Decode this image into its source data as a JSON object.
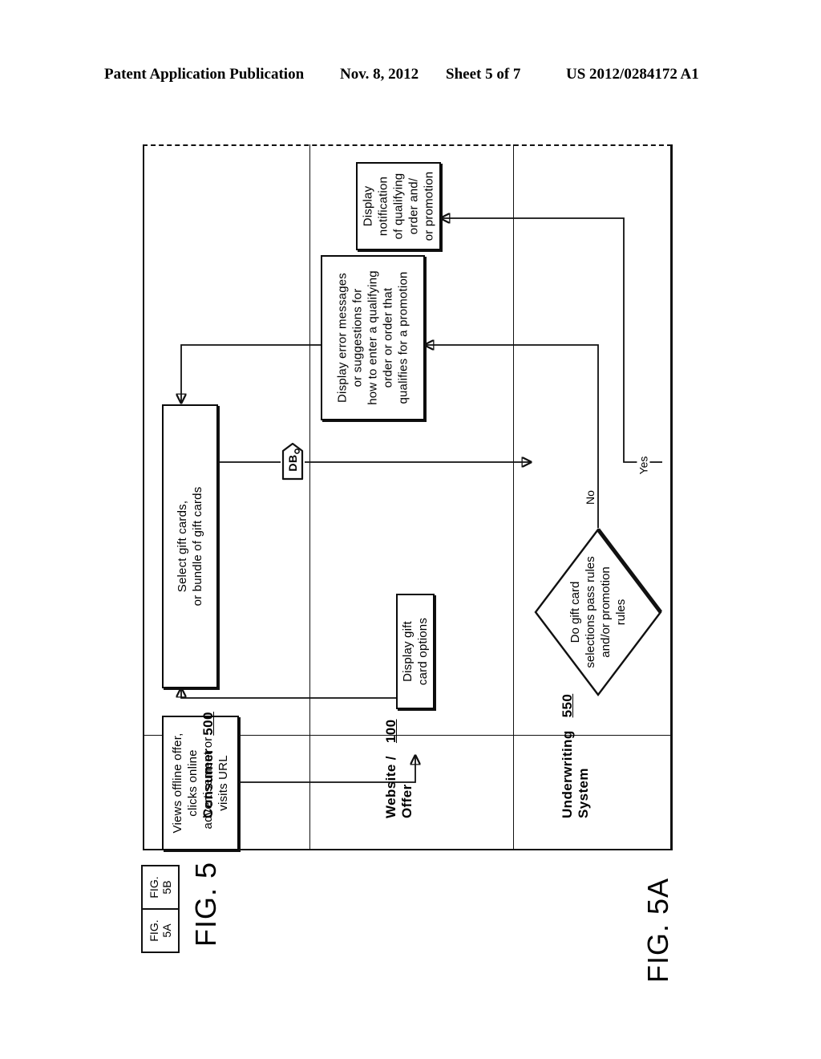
{
  "header": {
    "title": "Patent Application Publication",
    "date": "Nov. 8, 2012",
    "sheet": "Sheet 5 of 7",
    "publication_number": "US 2012/0284172 A1"
  },
  "figure": {
    "label": "FIG. 5A",
    "parent_label": "FIG. 5",
    "key_cells": [
      {
        "line1": "FIG.",
        "line2": "5A"
      },
      {
        "line1": "FIG.",
        "line2": "5B"
      }
    ]
  },
  "lanes": [
    {
      "name": "Consumer",
      "line1": "Consumer",
      "line2": "",
      "ref": "500"
    },
    {
      "name": "Website / Offer",
      "line1": "Website /",
      "line2": "Offer",
      "ref": "100"
    },
    {
      "name": "Underwriting System",
      "line1": "Underwriting",
      "line2": "System",
      "ref": "550"
    }
  ],
  "nodes": {
    "views_offer": {
      "type": "process",
      "lane": "Consumer",
      "lines": [
        "Views offline offer,",
        "clicks online",
        "advertisement or",
        "visits URL"
      ]
    },
    "select_gift_cards": {
      "type": "process",
      "lane": "Consumer",
      "lines": [
        "Select gift cards,",
        "or bundle of gift cards"
      ]
    },
    "display_card_options": {
      "type": "process",
      "lane": "Website / Offer",
      "lines": [
        "Display gift",
        "card options"
      ]
    },
    "display_error": {
      "type": "process",
      "lane": "Website / Offer",
      "lines": [
        "Display error messages",
        "or suggestions for",
        "how to enter a qualifying",
        "order or order that",
        "qualifies for a promotion"
      ]
    },
    "display_notification": {
      "type": "process",
      "lane": "Website / Offer",
      "lines": [
        "Display",
        "notification",
        "of qualifying",
        "order and/",
        "or promotion"
      ]
    },
    "decision_rules": {
      "type": "decision",
      "lane": "Website / Offer",
      "lines": [
        "Do gift card",
        "selections pass rules",
        "and/or promotion",
        "rules"
      ]
    },
    "database": {
      "type": "database",
      "label": "DB"
    }
  },
  "edge_labels": {
    "yes": "Yes",
    "no": "No"
  },
  "colors": {
    "ink": "#111111",
    "paper": "#ffffff"
  }
}
